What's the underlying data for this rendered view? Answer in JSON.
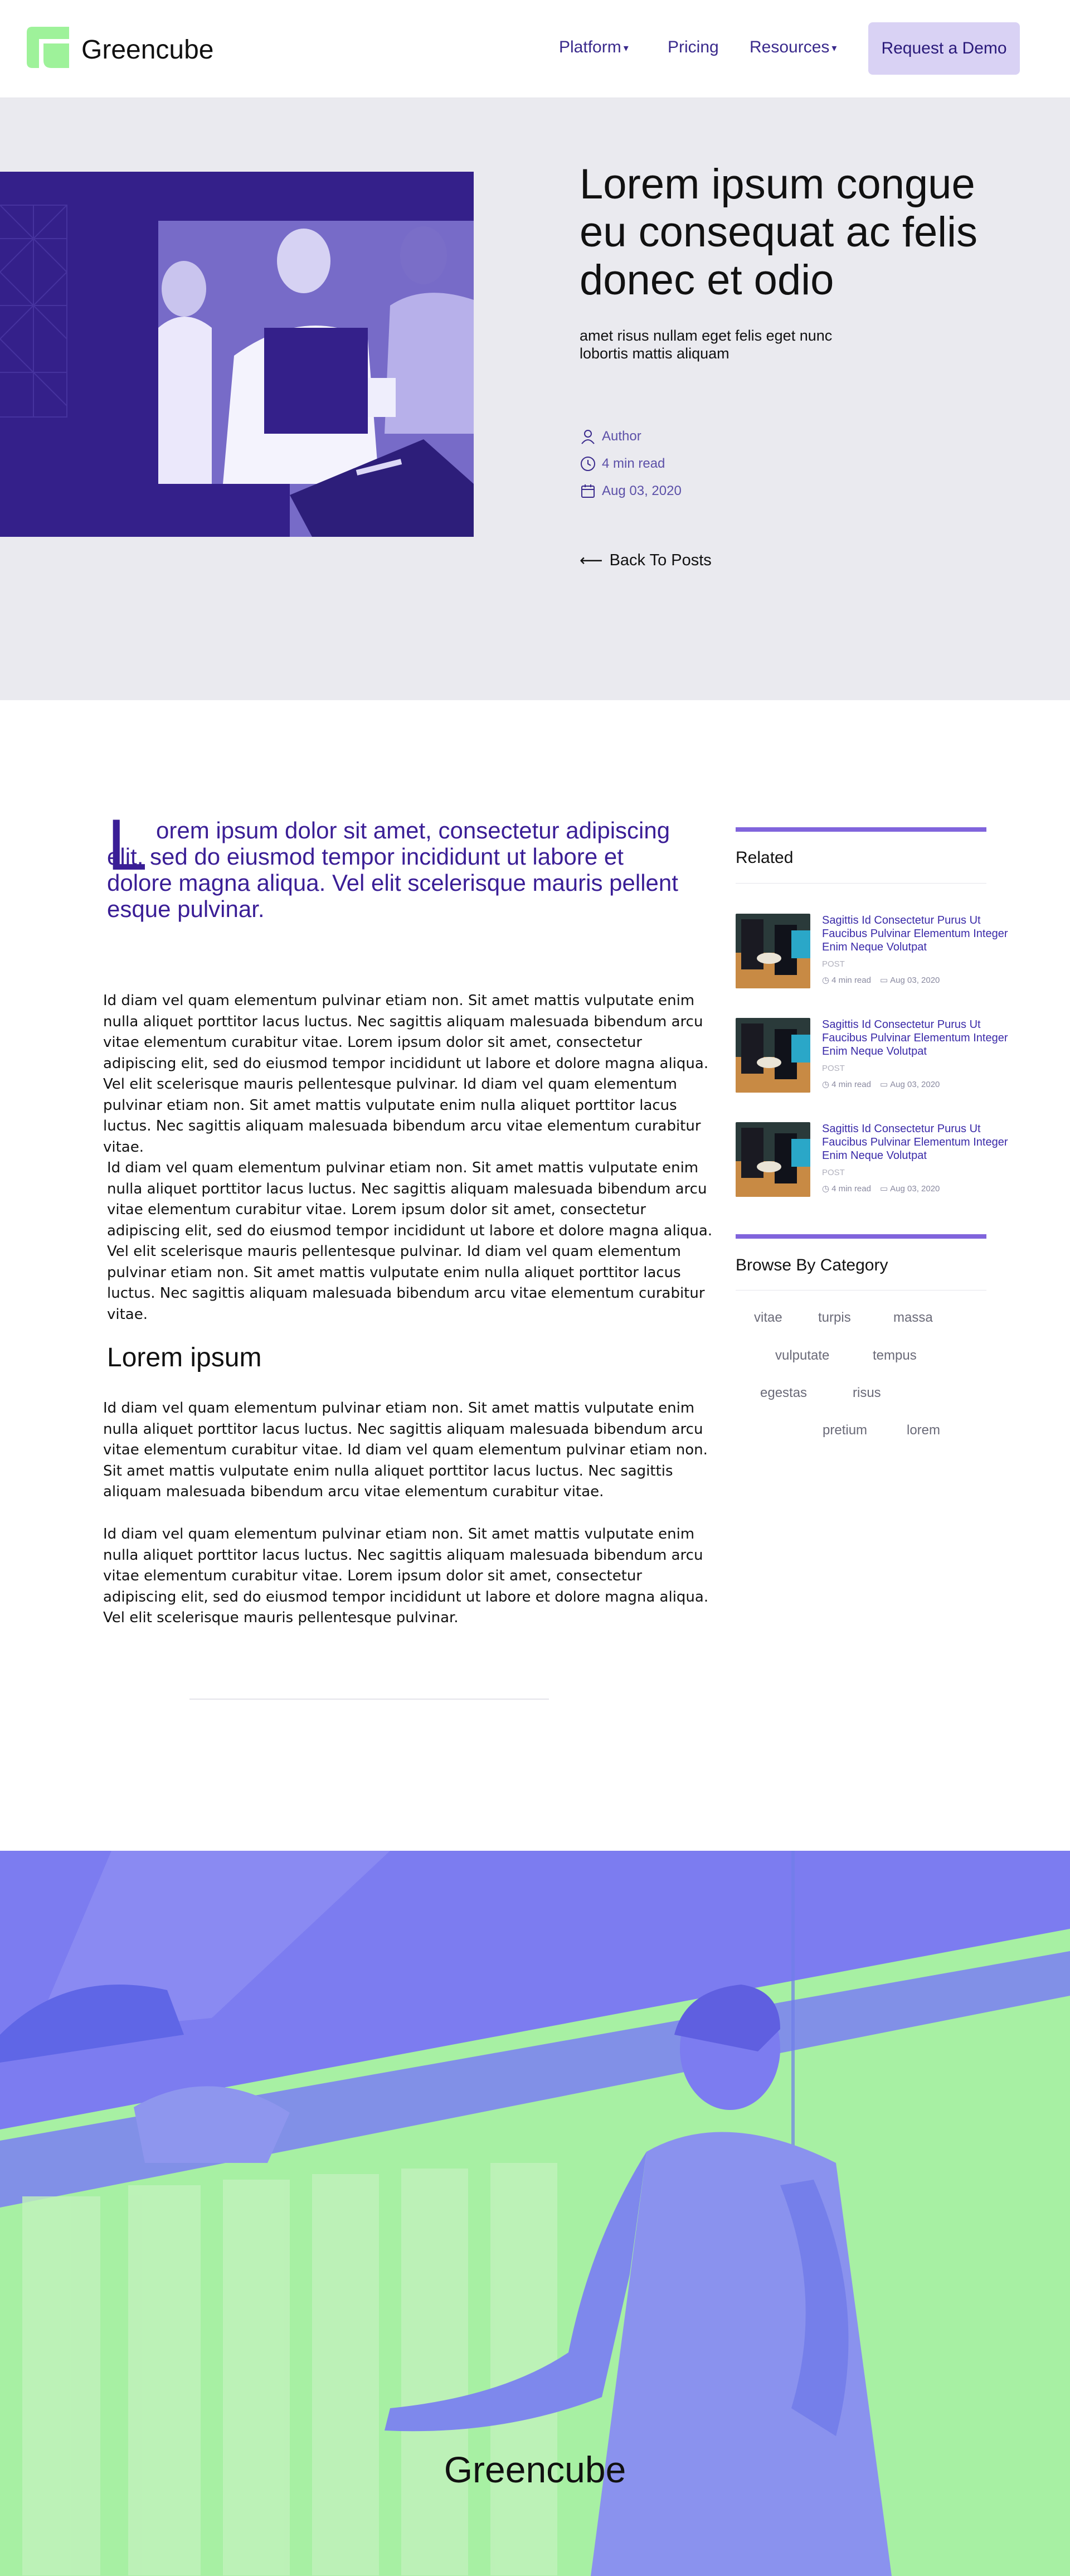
{
  "header": {
    "brand": "Greencube",
    "nav": {
      "platform": "Platform",
      "pricing": "Pricing",
      "resources": "Resources"
    },
    "cta": "Request a Demo"
  },
  "hero": {
    "title": "Lorem ipsum congue eu consequat ac felis donec et odio",
    "subtitle": "amet risus nullam eget felis eget nunc lobortis mattis aliquam",
    "author": "Author",
    "read_time": "4 min read",
    "date": "Aug 03, 2020",
    "back": "Back To Posts"
  },
  "article": {
    "lead_initial": "L",
    "lead": "orem ipsum dolor sit amet, consectetur adipiscing elit, sed do eiusmod tempor incididunt ut labore et dolore magna aliqua. Vel elit scelerisque mauris pellent esque pulvinar.",
    "p1": "Id diam vel quam elementum pulvinar etiam non. Sit amet mattis vulputate enim nulla aliquet porttitor lacus luctus. Nec sagittis aliquam malesuada bibendum arcu vitae elementum curabitur vitae. Lorem ipsum dolor sit amet, consectetur adipiscing elit, sed do eiusmod tempor incididunt ut labore et dolore magna aliqua. Vel elit scelerisque mauris pellentesque pulvinar. Id diam vel quam elementum pulvinar etiam non. Sit amet mattis vulputate enim nulla aliquet porttitor lacus luctus. Nec sagittis aliquam malesuada bibendum arcu vitae elementum curabitur vitae.",
    "p2": "Id diam vel quam elementum pulvinar etiam non. Sit amet mattis vulputate enim nulla aliquet porttitor lacus luctus. Nec sagittis aliquam malesuada bibendum arcu vitae elementum curabitur vitae. Lorem ipsum dolor sit amet, consectetur adipiscing elit, sed do eiusmod tempor incididunt ut labore et dolore magna aliqua. Vel elit scelerisque mauris pellentesque pulvinar. Id diam vel quam elementum pulvinar etiam non. Sit amet mattis vulputate enim nulla aliquet porttitor lacus luctus. Nec sagittis aliquam malesuada bibendum arcu vitae elementum curabitur vitae.",
    "heading": "Lorem ipsum",
    "p3": "Id diam vel quam elementum pulvinar etiam non. Sit amet mattis vulputate enim nulla aliquet porttitor lacus luctus. Nec sagittis aliquam malesuada bibendum arcu vitae elementum curabitur vitae. Id diam vel quam elementum pulvinar etiam non. Sit amet mattis vulputate enim nulla aliquet porttitor lacus luctus. Nec sagittis aliquam malesuada bibendum arcu vitae elementum curabitur vitae.",
    "p4": "Id diam vel quam elementum pulvinar etiam non. Sit amet mattis vulputate enim nulla aliquet porttitor lacus luctus. Nec sagittis aliquam malesuada bibendum arcu vitae elementum curabitur vitae. Lorem ipsum dolor sit amet, consectetur adipiscing elit, sed do eiusmod tempor incididunt ut labore et dolore magna aliqua. Vel elit scelerisque mauris pellentesque pulvinar."
  },
  "sidebar": {
    "related_title": "Related",
    "related": [
      {
        "title": "Sagittis Id Consectetur Purus Ut Faucibus Pulvinar Elementum Integer Enim Neque Volutpat",
        "type": "POST",
        "read_time": "4 min read",
        "date": "Aug 03, 2020"
      },
      {
        "title": "Sagittis Id Consectetur Purus Ut Faucibus Pulvinar Elementum Integer Enim Neque Volutpat",
        "type": "POST",
        "read_time": "4 min read",
        "date": "Aug 03, 2020"
      },
      {
        "title": "Sagittis Id Consectetur Purus Ut Faucibus Pulvinar Elementum Integer Enim Neque Volutpat",
        "type": "POST",
        "read_time": "4 min read",
        "date": "Aug 03, 2020"
      }
    ],
    "category_title": "Browse By Category",
    "tags": [
      "vitae",
      "turpis",
      "massa",
      "vulputate",
      "tempus",
      "egestas",
      "risus",
      "pretium",
      "lorem"
    ]
  },
  "footer": {
    "brand": "Greencube"
  },
  "colors": {
    "brand_purple": "#34208a",
    "accent_violet": "#8064dc",
    "brand_green": "#9ef29a",
    "hero_bg": "#eaeaef"
  }
}
